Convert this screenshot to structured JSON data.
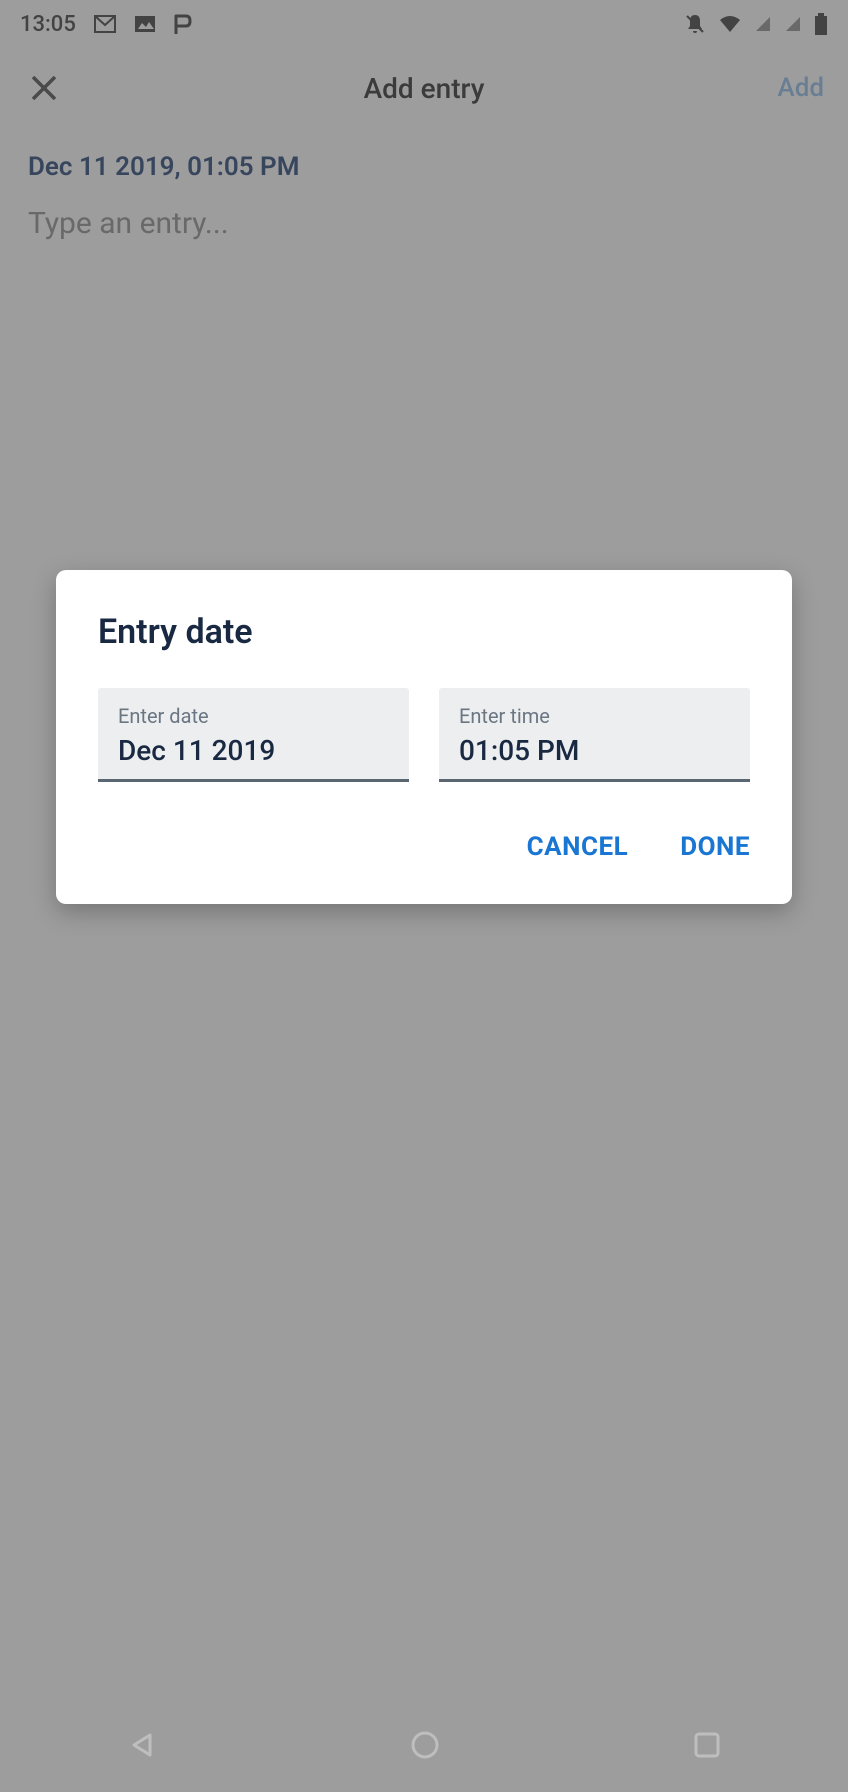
{
  "status_bar": {
    "time": "13:05"
  },
  "header": {
    "title": "Add entry",
    "add_label": "Add"
  },
  "content": {
    "date_display": "Dec 11 2019, 01:05 PM",
    "entry_placeholder": "Type an entry..."
  },
  "dialog": {
    "title": "Entry date",
    "date_field": {
      "label": "Enter date",
      "value": "Dec 11 2019"
    },
    "time_field": {
      "label": "Enter time",
      "value": "01:05 PM"
    },
    "cancel_label": "CANCEL",
    "done_label": "DONE"
  }
}
